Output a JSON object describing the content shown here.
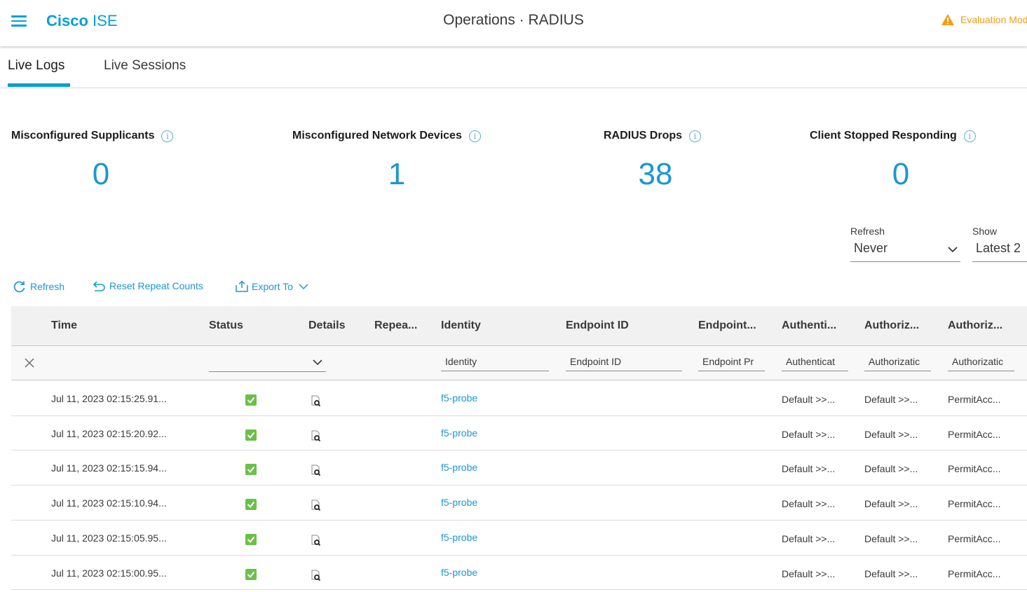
{
  "header": {
    "brand_bold": "Cisco",
    "brand_rest": "ISE",
    "title": "Operations · RADIUS",
    "evaluation": "Evaluation Mod",
    "accent": "#049fd9",
    "warning_color": "#f49b13"
  },
  "tabs": [
    {
      "label": "Live Logs",
      "active": true
    },
    {
      "label": "Live Sessions",
      "active": false
    }
  ],
  "metrics": [
    {
      "label": "Misconfigured Supplicants",
      "value": "0"
    },
    {
      "label": "Misconfigured Network Devices",
      "value": "1"
    },
    {
      "label": "RADIUS Drops",
      "value": "38"
    },
    {
      "label": "Client Stopped Responding",
      "value": "0"
    }
  ],
  "refresh": {
    "label": "Refresh",
    "value": "Never"
  },
  "show": {
    "label": "Show",
    "value": "Latest 2"
  },
  "toolbar": {
    "refresh_label": "Refresh",
    "reset_label": "Reset Repeat Counts",
    "export_label": "Export To"
  },
  "table": {
    "columns": [
      "Time",
      "Status",
      "Details",
      "Repea...",
      "Identity",
      "Endpoint ID",
      "Endpoint...",
      "Authenti...",
      "Authoriz...",
      "Authoriz..."
    ],
    "filters": {
      "identity": "Identity",
      "endpoint_id": "Endpoint ID",
      "endpoint_profile": "Endpoint Pr",
      "authentication": "Authenticat",
      "authorization_policy": "Authorizatic",
      "authorization_profile": "Authorizatic"
    },
    "rows": [
      {
        "time": "Jul 11, 2023 02:15:25.91...",
        "status": "success",
        "identity": "f5-probe",
        "authn": "Default >>...",
        "authz_policy": "Default >>...",
        "authz_profile": "PermitAcc..."
      },
      {
        "time": "Jul 11, 2023 02:15:20.92...",
        "status": "success",
        "identity": "f5-probe",
        "authn": "Default >>...",
        "authz_policy": "Default >>...",
        "authz_profile": "PermitAcc..."
      },
      {
        "time": "Jul 11, 2023 02:15:15.94...",
        "status": "success",
        "identity": "f5-probe",
        "authn": "Default >>...",
        "authz_policy": "Default >>...",
        "authz_profile": "PermitAcc..."
      },
      {
        "time": "Jul 11, 2023 02:15:10.94...",
        "status": "success",
        "identity": "f5-probe",
        "authn": "Default >>...",
        "authz_policy": "Default >>...",
        "authz_profile": "PermitAcc..."
      },
      {
        "time": "Jul 11, 2023 02:15:05.95...",
        "status": "success",
        "identity": "f5-probe",
        "authn": "Default >>...",
        "authz_policy": "Default >>...",
        "authz_profile": "PermitAcc..."
      },
      {
        "time": "Jul 11, 2023 02:15:00.95...",
        "status": "success",
        "identity": "f5-probe",
        "authn": "Default >>...",
        "authz_policy": "Default >>...",
        "authz_profile": "PermitAcc..."
      }
    ]
  },
  "icons": [
    "hamburger-icon",
    "warning-icon",
    "info-icon",
    "refresh-icon",
    "undo-icon",
    "export-icon",
    "chevron-down-icon",
    "close-icon",
    "check-icon",
    "details-icon"
  ]
}
